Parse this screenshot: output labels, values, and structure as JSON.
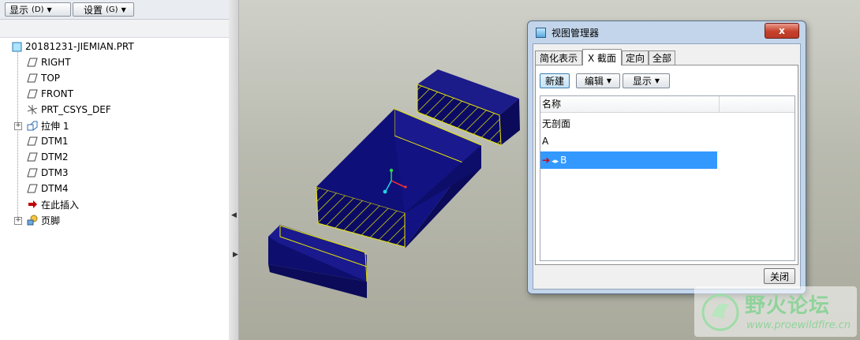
{
  "toolbar": {
    "display_label": "显示",
    "display_shortcut": "(D)",
    "settings_label": "设置",
    "settings_shortcut": "(G)"
  },
  "tree": {
    "root": "20181231-JIEMIAN.PRT",
    "items": [
      {
        "label": "RIGHT",
        "icon": "datum-plane-icon"
      },
      {
        "label": "TOP",
        "icon": "datum-plane-icon"
      },
      {
        "label": "FRONT",
        "icon": "datum-plane-icon"
      },
      {
        "label": "PRT_CSYS_DEF",
        "icon": "coordinate-system-icon"
      },
      {
        "label": "拉伸 1",
        "icon": "extrude-icon"
      },
      {
        "label": "DTM1",
        "icon": "datum-plane-icon"
      },
      {
        "label": "DTM2",
        "icon": "datum-plane-icon"
      },
      {
        "label": "DTM3",
        "icon": "datum-plane-icon"
      },
      {
        "label": "DTM4",
        "icon": "datum-plane-icon"
      },
      {
        "label": "在此插入",
        "icon": "insert-here-arrow-icon"
      },
      {
        "label": "页脚",
        "icon": "footer-icon"
      }
    ]
  },
  "dialog": {
    "title": "视图管理器",
    "close_glyph": "x",
    "tabs": [
      {
        "label": "简化表示",
        "active": false
      },
      {
        "label": "X 截面",
        "active": true
      },
      {
        "label": "定向",
        "active": false
      },
      {
        "label": "全部",
        "active": false
      }
    ],
    "buttons": {
      "new": "新建",
      "edit": "编辑",
      "display": "显示"
    },
    "list_header": "名称",
    "list_rows": [
      {
        "label": "无剖面",
        "selected": false
      },
      {
        "label": "A",
        "selected": false
      },
      {
        "label": "B",
        "selected": true
      }
    ],
    "close_button": "关闭"
  },
  "watermark": {
    "name": "野火论坛",
    "url": "www.proewildfire.cn"
  },
  "colors": {
    "model": "#0b0b66",
    "model_side": "#131380",
    "section_edge": "#e6e600",
    "selection": "#3399ff",
    "viewport_bg": "#c0c1b6"
  }
}
